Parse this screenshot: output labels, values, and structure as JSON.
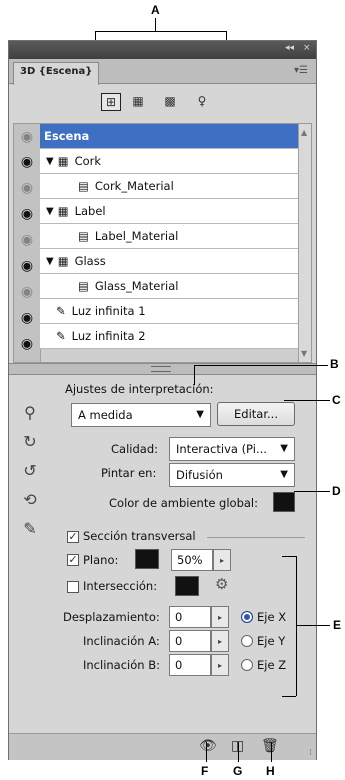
{
  "callouts": {
    "A": "A",
    "B": "B",
    "C": "C",
    "D": "D",
    "E": "E",
    "F": "F",
    "G": "G",
    "H": "H"
  },
  "window": {
    "tab_title": "3D {Escena}",
    "controls": [
      "◂◂",
      "×"
    ],
    "menu_icon": "panel-menu-icon"
  },
  "toolbar_icons": [
    "scene-icon",
    "mesh-icon",
    "material-icon",
    "light-icon"
  ],
  "scene": {
    "header": "Escena",
    "items": [
      {
        "label": "Cork",
        "type": "mesh",
        "expanded": true
      },
      {
        "label": "Cork_Material",
        "type": "material"
      },
      {
        "label": "Label",
        "type": "mesh",
        "expanded": true
      },
      {
        "label": "Label_Material",
        "type": "material"
      },
      {
        "label": "Glass",
        "type": "mesh",
        "expanded": true
      },
      {
        "label": "Glass_Material",
        "type": "material"
      },
      {
        "label": "Luz infinita 1",
        "type": "light"
      },
      {
        "label": "Luz infinita 2",
        "type": "light"
      }
    ]
  },
  "settings": {
    "render_settings_label": "Ajustes de interpretación:",
    "render_preset": "A medida",
    "edit_button": "Editar...",
    "quality_label": "Calidad:",
    "quality_value": "Interactiva (Pi...",
    "paint_on_label": "Pintar en:",
    "paint_on_value": "Difusión",
    "ambient_label": "Color de ambiente global:",
    "cross_section_label": "Sección transversal",
    "plane_label": "Plano:",
    "plane_opacity": "50%",
    "intersection_label": "Intersección:",
    "offset_label": "Desplazamiento:",
    "offset_value": "0",
    "tilt_a_label": "Inclinación A:",
    "tilt_a_value": "0",
    "tilt_b_label": "Inclinación B:",
    "tilt_b_value": "0",
    "axis_x": "Eje X",
    "axis_y": "Eje Y",
    "axis_z": "Eje Z",
    "selected_axis": "Eje X"
  },
  "colors": {
    "selection": "#3d6fc2",
    "panel": "#d6d6d6",
    "swatch": "#111111"
  }
}
